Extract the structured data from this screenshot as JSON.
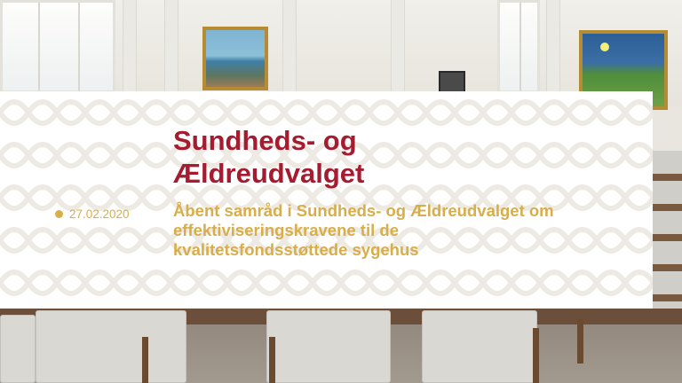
{
  "overlay": {
    "title_line1": "Sundheds- og",
    "title_line2": "Ældreudvalget",
    "date": "27.02.2020",
    "subtitle_line1": "Åbent samråd i Sundheds- og Ældreudvalget om",
    "subtitle_line2": "effektiviseringskravene til de",
    "subtitle_line3": "kvalitetsfondsstøttede sygehus"
  },
  "colors": {
    "title": "#a51c30",
    "accent": "#d8ae4a",
    "card_background": "#ffffff"
  }
}
